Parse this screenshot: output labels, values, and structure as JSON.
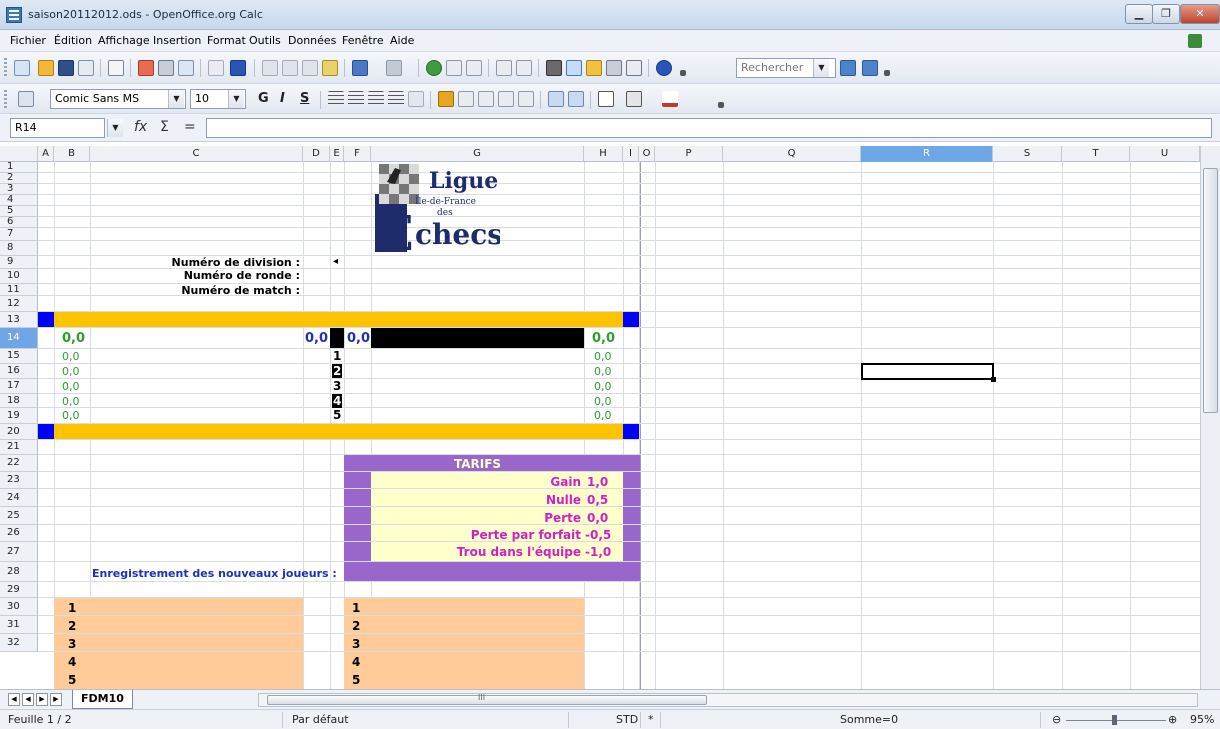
{
  "window": {
    "title": "saison20112012.ods - OpenOffice.org Calc"
  },
  "menu": [
    "Fichier",
    "Édition",
    "Affichage",
    "Insertion",
    "Format",
    "Outils",
    "Données",
    "Fenêtre",
    "Aide"
  ],
  "toolbar": {
    "search_placeholder": "Rechercher"
  },
  "format": {
    "font_name": "Comic Sans MS",
    "font_size": "10",
    "bold": "G",
    "italic": "I",
    "underline": "S"
  },
  "formula": {
    "cell_ref": "R14",
    "fx": "fx",
    "sum": "Σ",
    "equals": "="
  },
  "columns": [
    "A",
    "B",
    "C",
    "D",
    "E",
    "F",
    "G",
    "H",
    "I",
    "O",
    "P",
    "Q",
    "R",
    "S",
    "T",
    "U"
  ],
  "rows": [
    "1",
    "2",
    "3",
    "4",
    "5",
    "6",
    "7",
    "8",
    "9",
    "10",
    "11",
    "12",
    "13",
    "14",
    "15",
    "16",
    "17",
    "18",
    "19",
    "20",
    "21",
    "22",
    "23",
    "24",
    "25",
    "26",
    "27",
    "28",
    "29",
    "30",
    "31",
    "32"
  ],
  "logo": {
    "word1": "Ligue",
    "word2": "Île-de-France",
    "word3": "des",
    "initial": "E",
    "word4": "checs"
  },
  "labels": {
    "division": "Numéro de division :",
    "ronde": "Numéro de ronde :",
    "match": "Numéro de match :",
    "arrow": "◂",
    "registration": "Enregistrement des nouveaux joueurs :"
  },
  "scores": {
    "b12": "0,0",
    "d12": "0,0",
    "f12": "0,0",
    "h12": "0,0",
    "left": [
      "0,0",
      "0,0",
      "0,0",
      "0,0",
      "0,0"
    ],
    "right": [
      "0,0",
      "0,0",
      "0,0",
      "0,0",
      "0,0"
    ],
    "boards": [
      "1",
      "2",
      "3",
      "4",
      "5"
    ]
  },
  "tarifs": {
    "title": "TARIFS",
    "rows": [
      {
        "label": "Gain",
        "value": "1,0"
      },
      {
        "label": "Nulle",
        "value": "0,5"
      },
      {
        "label": "Perte",
        "value": "0,0"
      },
      {
        "label": "Perte par forfait",
        "value": "-0,5"
      },
      {
        "label": "Trou dans l'équipe",
        "value": "-1,0"
      }
    ]
  },
  "players": {
    "left": [
      "1",
      "2",
      "3",
      "4",
      "5"
    ],
    "right": [
      "1",
      "2",
      "3",
      "4",
      "5"
    ]
  },
  "sheet": {
    "tab": "FDM10",
    "hscroll_label": "III"
  },
  "status": {
    "sheet": "Feuille 1 / 2",
    "style": "Par défaut",
    "mode": "STD",
    "modified": "*",
    "sum": "Somme=0",
    "zoom": "95%"
  },
  "colors": {
    "yellow": "#ffc400",
    "blue": "#0000ff",
    "black": "#000000",
    "purple": "#9966cc",
    "cream": "#ffffcc",
    "salmon": "#ffcc99",
    "magenta": "#d020c8",
    "green": "#2e9d2e"
  }
}
